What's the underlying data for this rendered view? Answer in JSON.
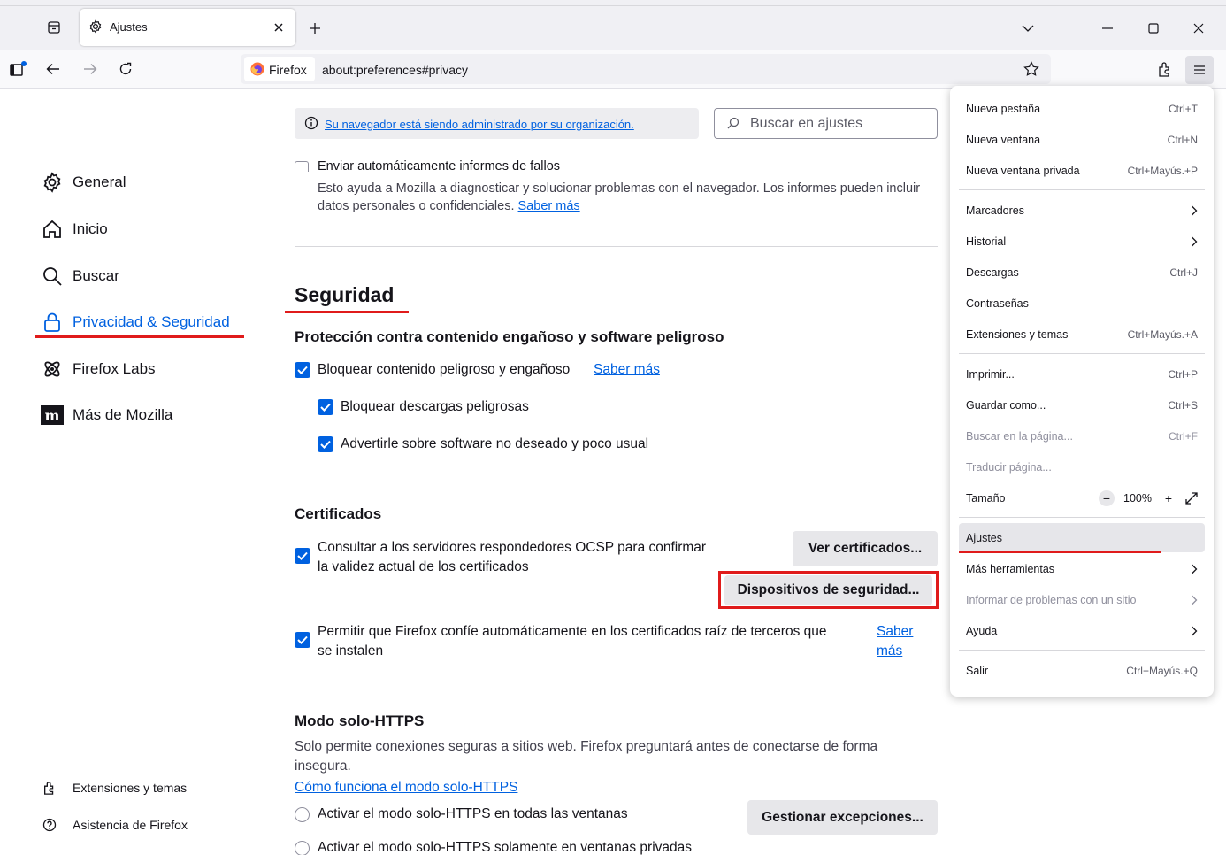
{
  "tabbar": {
    "tab_title": "Ajustes"
  },
  "navbar": {
    "identity_label": "Firefox",
    "url": "about:preferences#privacy"
  },
  "sidebar": {
    "items": [
      {
        "label": "General",
        "icon": "gear-icon"
      },
      {
        "label": "Inicio",
        "icon": "home-icon"
      },
      {
        "label": "Buscar",
        "icon": "search-icon"
      },
      {
        "label": "Privacidad & Seguridad",
        "icon": "lock-icon",
        "selected": true
      },
      {
        "label": "Firefox Labs",
        "icon": "labs-icon"
      },
      {
        "label": "Más de Mozilla",
        "icon": "mozilla-icon"
      }
    ],
    "footer": {
      "extensions": "Extensiones y temas",
      "support": "Asistencia de Firefox"
    }
  },
  "main": {
    "policy_link": "Su navegador está siendo administrado por su organización.",
    "search_placeholder": "Buscar en ajustes",
    "crash_reports_label": "Enviar automáticamente informes de fallos",
    "crash_reports_desc": "Esto ayuda a Mozilla a diagnosticar y solucionar problemas con el navegador. Los informes pueden incluir datos personales o confidenciales.",
    "learn_more": "Saber más",
    "security_title": "Seguridad",
    "protection_title": "Protección contra contenido engañoso y software peligroso",
    "block_dangerous": "Bloquear contenido peligroso y engañoso",
    "block_downloads": "Bloquear descargas peligrosas",
    "warn_unwanted": "Advertirle sobre software no deseado y poco usual",
    "certificates_title": "Certificados",
    "ocsp_line1": "Consultar a los servidores respondedores OCSP para confirmar",
    "ocsp_line2": "la validez actual de los certificados",
    "view_certs_button": "Ver certificados...",
    "security_devices_button": "Dispositivos de seguridad...",
    "third_party_line1": "Permitir que Firefox confíe automáticamente en los certificados raíz de terceros que",
    "third_party_line2": "se instalen",
    "learn_more_1": "Saber",
    "learn_more_2": "más",
    "https_title": "Modo solo-HTTPS",
    "https_desc_1": "Solo permite conexiones seguras a sitios web. Firefox preguntará antes de conectarse de forma",
    "https_desc_2": "insegura.",
    "https_link": "Cómo funciona el modo solo-HTTPS",
    "https_all": "Activar el modo solo-HTTPS en todas las ventanas",
    "https_private": "Activar el modo solo-HTTPS solamente en ventanas privadas",
    "manage_exceptions_button": "Gestionar excepciones..."
  },
  "app_menu": {
    "items": [
      {
        "label": "Nueva pestaña",
        "key": "Ctrl+T"
      },
      {
        "label": "Nueva ventana",
        "key": "Ctrl+N"
      },
      {
        "label": "Nueva ventana privada",
        "key": "Ctrl+Mayús.+P"
      },
      {
        "label": "Marcadores",
        "key": ">"
      },
      {
        "label": "Historial",
        "key": ">"
      },
      {
        "label": "Descargas",
        "key": "Ctrl+J"
      },
      {
        "label": "Contraseñas",
        "key": ""
      },
      {
        "label": "Extensiones y temas",
        "key": "Ctrl+Mayús.+A"
      },
      {
        "label": "Imprimir...",
        "key": "Ctrl+P"
      },
      {
        "label": "Guardar como...",
        "key": "Ctrl+S"
      },
      {
        "label": "Buscar en la página...",
        "key": "Ctrl+F"
      },
      {
        "label": "Traducir página...",
        "key": ""
      },
      {
        "label": "Tamaño",
        "key": ""
      },
      {
        "label": "Ajustes",
        "key": ""
      },
      {
        "label": "Más herramientas",
        "key": ">"
      },
      {
        "label": "Informar de problemas con un sitio",
        "key": ">"
      },
      {
        "label": "Ayuda",
        "key": ">"
      },
      {
        "label": "Salir",
        "key": "Ctrl+Mayús.+Q"
      }
    ],
    "zoom_value": "100%",
    "zoom_minus": "−",
    "zoom_plus": "+"
  },
  "colors": {
    "accent": "#0061e0",
    "highlight_red": "#e01b1b"
  }
}
